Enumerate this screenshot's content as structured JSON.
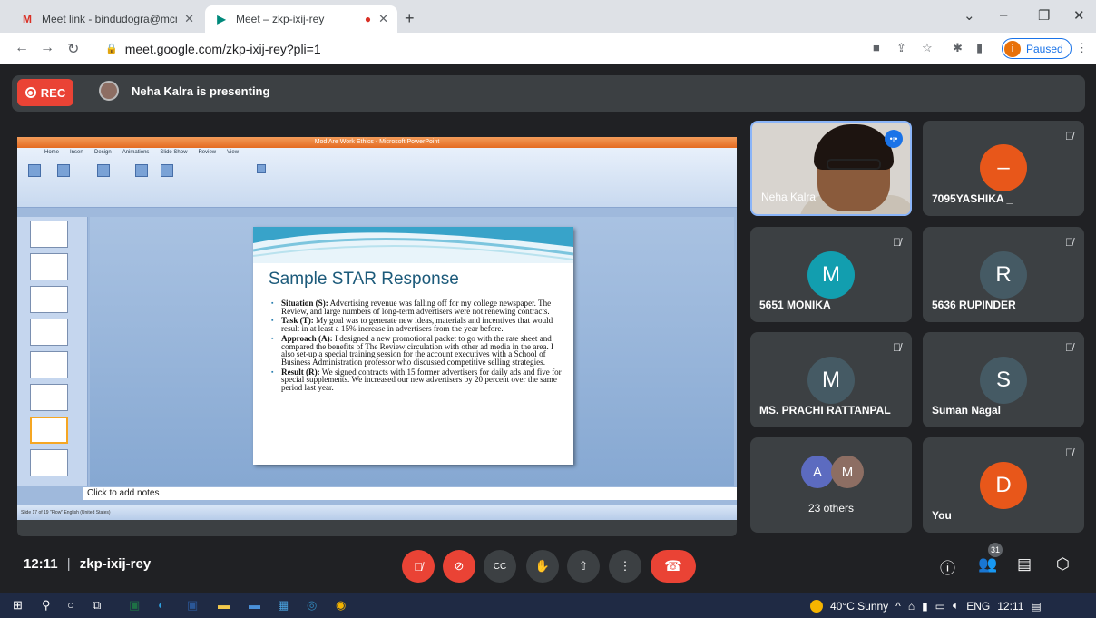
{
  "browser": {
    "tabs": [
      {
        "title": "Meet link - bindudogra@mcmda",
        "favicon": "gmail-icon"
      },
      {
        "title": "Meet – zkp-ixij-rey",
        "favicon": "meet-icon"
      }
    ],
    "url": "meet.google.com/zkp-ixij-rey?pli=1",
    "profile_initial": "i",
    "profile_status": "Paused"
  },
  "meet": {
    "rec_label": "REC",
    "presenting_text": "Neha Kalra is presenting",
    "meeting_time": "12:11",
    "meeting_code": "zkp-ixij-rey",
    "participant_count": "31",
    "participants": [
      {
        "name": "Neha Kalra",
        "type": "video"
      },
      {
        "name": "7095YASHIKA _",
        "initial": "–",
        "color": "#e8571a"
      },
      {
        "name": "5651 MONIKA",
        "initial": "M",
        "color": "#129eaf"
      },
      {
        "name": "5636 RUPINDER",
        "initial": "R",
        "color": "#455a64"
      },
      {
        "name": "MS. PRACHI RATTANPAL",
        "initial": "M",
        "color": "#455a64"
      },
      {
        "name": "Suman Nagal",
        "initial": "S",
        "color": "#455a64"
      },
      {
        "name": "23 others",
        "initials": [
          "A",
          "M"
        ],
        "colors": [
          "#5c6bc0",
          "#8d6e63"
        ]
      },
      {
        "name": "You",
        "initial": "D",
        "color": "#e8571a"
      }
    ]
  },
  "presentation": {
    "window_title": "Mod Are Work Ethics - Microsoft PowerPoint",
    "ribbon_tabs": [
      "Home",
      "Insert",
      "Design",
      "Animations",
      "Slide Show",
      "Review",
      "View"
    ],
    "slide_title": "Sample STAR Response",
    "bullets": [
      {
        "head": "Situation (S):",
        "text": " Advertising revenue was falling off for my college newspaper. The Review, and large numbers of long-term advertisers were not renewing contracts."
      },
      {
        "head": "Task (T):",
        "text": " My goal was to generate new ideas, materials and incentives that would result in at least a 15% increase in advertisers from the year before."
      },
      {
        "head": "Approach (A):",
        "text": " I designed a new promotional packet to go with the rate sheet and compared the benefits of The Review circulation with other ad media in the area. I also set-up a special training session for the account executives with a School of Business Administration professor who discussed competitive selling strategies."
      },
      {
        "head": "Result (R):",
        "text": " We signed contracts with 15 former advertisers for daily ads and five for special supplements. We increased our new advertisers by 20 percent over the same period last year."
      }
    ],
    "notes_placeholder": "Click to add notes",
    "status": "Slide 17 of 19   \"Flow\"   English (United States)"
  },
  "taskbar": {
    "weather": "40°C  Sunny",
    "language": "ENG",
    "time": "12:11"
  }
}
